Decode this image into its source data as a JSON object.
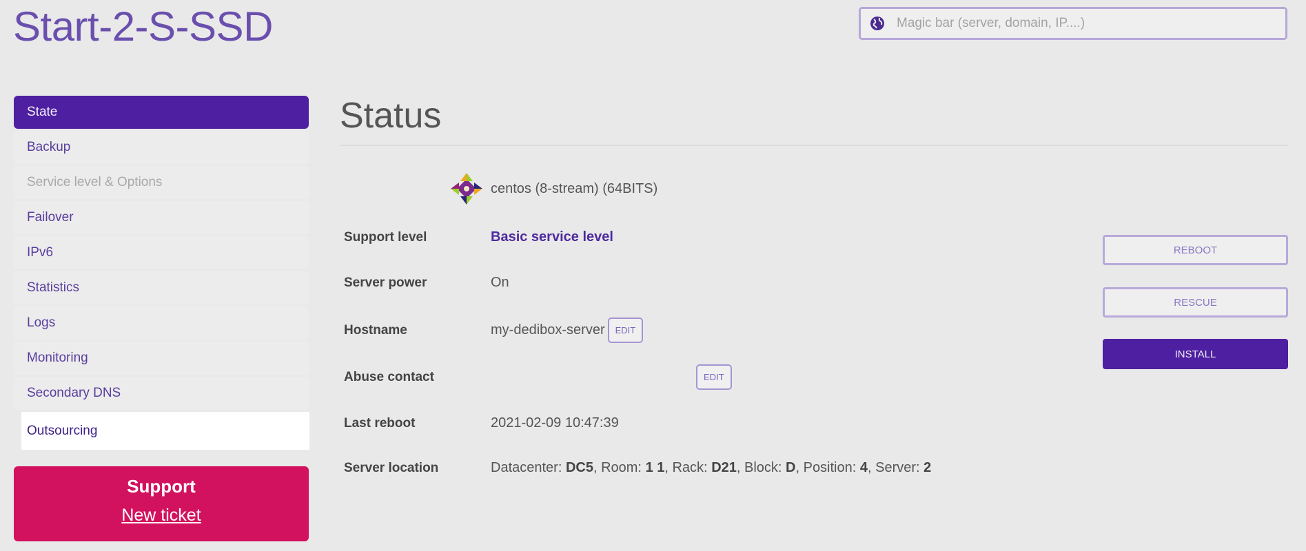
{
  "header": {
    "title": "Start-2-S-SSD",
    "magic_bar_placeholder": "Magic bar (server, domain, IP....)"
  },
  "sidebar": {
    "items": [
      {
        "label": "State",
        "state": "active"
      },
      {
        "label": "Backup"
      },
      {
        "label": "Service level & Options",
        "state": "disabled"
      },
      {
        "label": "Failover"
      },
      {
        "label": "IPv6"
      },
      {
        "label": "Statistics"
      },
      {
        "label": "Logs"
      },
      {
        "label": "Monitoring"
      },
      {
        "label": "Secondary DNS"
      },
      {
        "label": "Outsourcing",
        "state": "hover"
      }
    ]
  },
  "support": {
    "title": "Support",
    "link": "New ticket"
  },
  "main": {
    "title": "Status",
    "os": "centos (8-stream) (64BITS)",
    "rows": {
      "support_level": {
        "label": "Support level",
        "value": "Basic service level"
      },
      "server_power": {
        "label": "Server power",
        "value": "On"
      },
      "hostname": {
        "label": "Hostname",
        "value": "my-dedibox-server",
        "edit": "EDIT"
      },
      "abuse_contact": {
        "label": "Abuse contact",
        "value": "",
        "edit": "EDIT"
      },
      "last_reboot": {
        "label": "Last reboot",
        "value": "2021-02-09 10:47:39"
      },
      "server_location": {
        "label": "Server location",
        "datacenter_label": "Datacenter:",
        "datacenter": "DC5",
        "room_label": ", Room:",
        "room": "1 1",
        "rack_label": ", Rack:",
        "rack": "D21",
        "block_label": ", Block:",
        "block": "D",
        "position_label": ", Position:",
        "position": "4",
        "server_label": ", Server:",
        "server": "2"
      }
    },
    "actions": {
      "reboot": "REBOOT",
      "rescue": "RESCUE",
      "install": "INSTALL"
    }
  },
  "colors": {
    "brand": "#4e1fa0",
    "support": "#d2125e",
    "background": "#e9e9e9"
  }
}
